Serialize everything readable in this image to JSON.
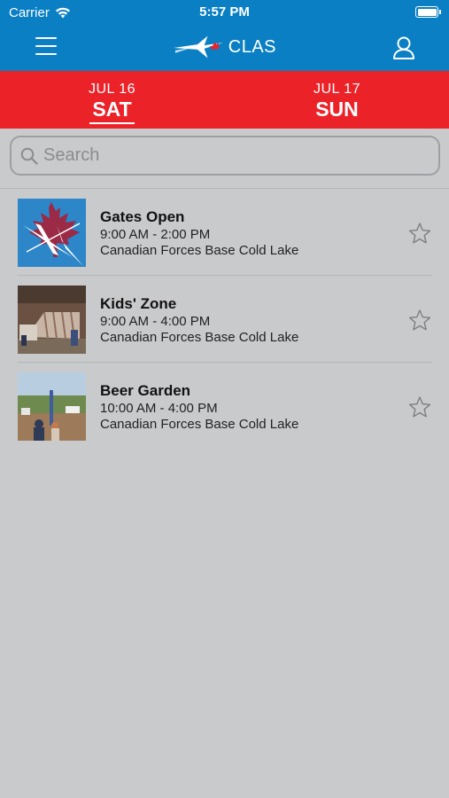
{
  "status": {
    "carrier": "Carrier",
    "time": "5:57 PM"
  },
  "navbar": {
    "logo_text": "CLAS",
    "menu_icon": "hamburger-icon",
    "profile_icon": "user-icon"
  },
  "days": [
    {
      "month": "JUL 16",
      "dow": "SAT",
      "active": true
    },
    {
      "month": "JUL 17",
      "dow": "SUN",
      "active": false
    }
  ],
  "search": {
    "placeholder": "Search",
    "value": ""
  },
  "events": [
    {
      "title": "Gates Open",
      "time": "9:00 AM - 2:00 PM",
      "location": "Canadian Forces Base Cold Lake",
      "favorited": false
    },
    {
      "title": "Kids' Zone",
      "time": "9:00 AM - 4:00 PM",
      "location": "Canadian Forces Base Cold Lake",
      "favorited": false
    },
    {
      "title": "Beer Garden",
      "time": "10:00 AM - 4:00 PM",
      "location": "Canadian Forces Base Cold Lake",
      "favorited": false
    }
  ],
  "colors": {
    "nav_blue": "#0a7fc4",
    "date_red": "#ec2229",
    "background": "#c9cacc"
  }
}
